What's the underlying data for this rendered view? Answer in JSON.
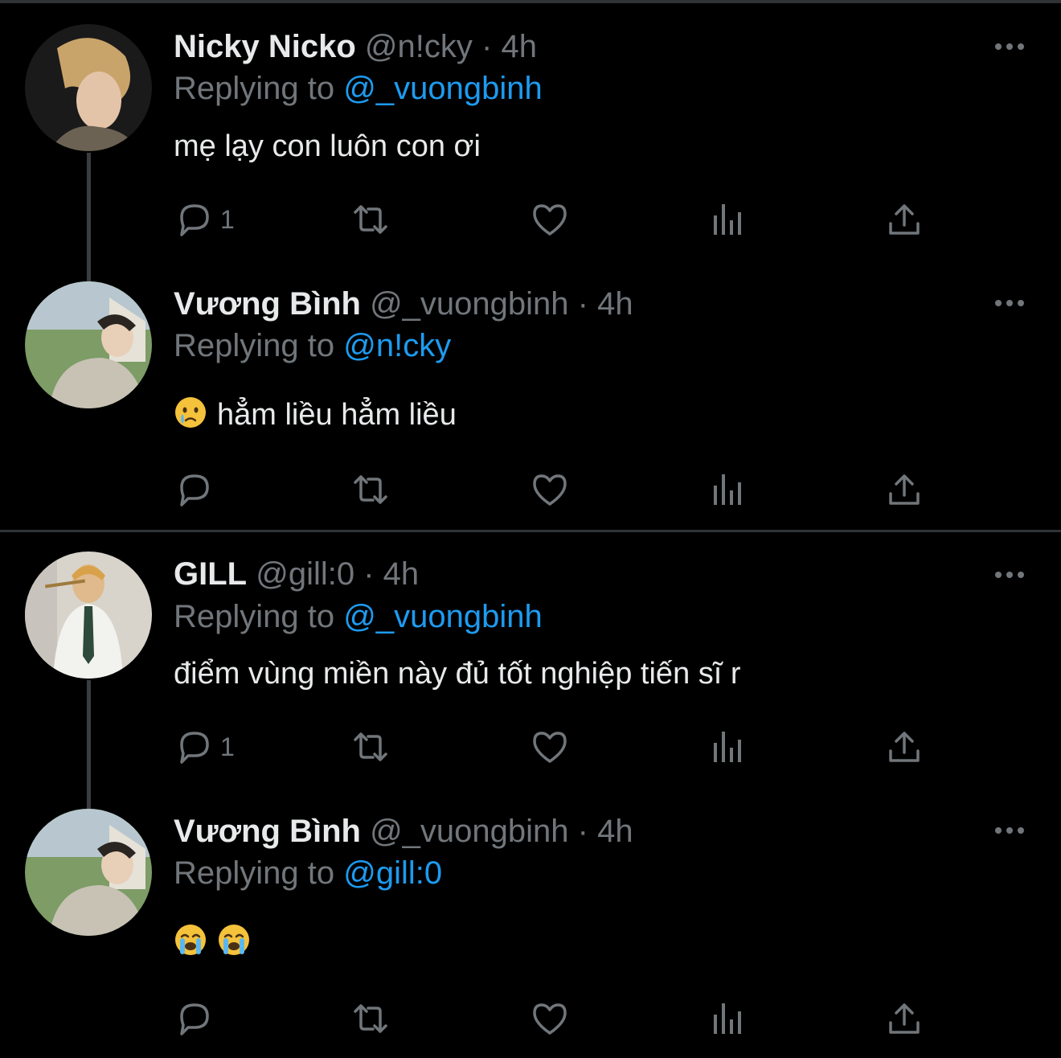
{
  "tweets": [
    {
      "name": "Nicky Nicko",
      "handle": "@n!cky",
      "dot": "·",
      "time": "4h",
      "reply_prefix": "Replying to",
      "reply_to": "@_vuongbinh",
      "text": "mẹ lạy con luôn con ơi",
      "reply_count": "1",
      "avatar_icon": "profile-photo"
    },
    {
      "name": "Vương Bình",
      "handle": "@_vuongbinh",
      "dot": "·",
      "time": "4h",
      "reply_prefix": "Replying to",
      "reply_to": "@n!cky",
      "text": "hẳm liều hẳm liều",
      "emoji": "crying-face-emoji",
      "reply_count": "",
      "avatar_icon": "profile-photo"
    },
    {
      "name": "GILL",
      "handle": "@gill:0",
      "dot": "·",
      "time": "4h",
      "reply_prefix": "Replying to",
      "reply_to": "@_vuongbinh",
      "text": "điểm vùng miền này đủ tốt nghiệp tiến sĩ r",
      "reply_count": "1",
      "avatar_icon": "profile-photo"
    },
    {
      "name": "Vương Bình",
      "handle": "@_vuongbinh",
      "dot": "·",
      "time": "4h",
      "reply_prefix": "Replying to",
      "reply_to": "@gill:0",
      "text": "",
      "emoji": "loudly-crying-face-emoji",
      "reply_count": "",
      "avatar_icon": "profile-photo"
    }
  ],
  "colors": {
    "background": "#000000",
    "text": "#e7e9ea",
    "muted": "#71767b",
    "link": "#1d9bf0",
    "divider": "#2f3336"
  }
}
